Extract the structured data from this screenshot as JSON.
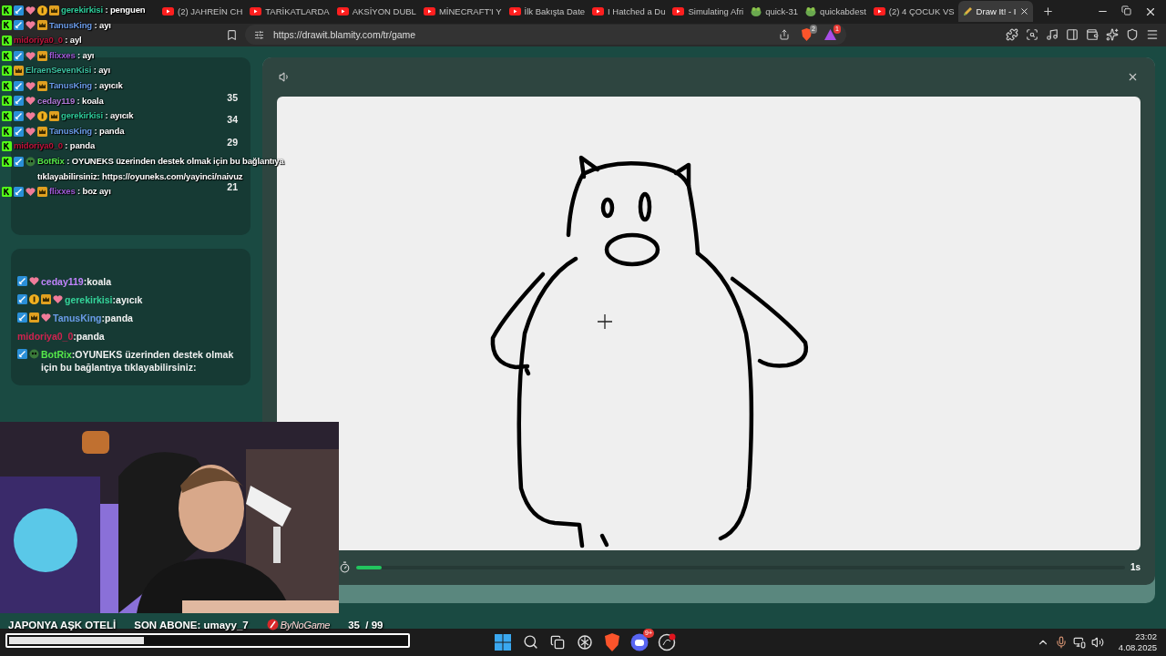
{
  "browser": {
    "tabs": [
      {
        "title": "(2) JAHREİN CH",
        "kind": "video",
        "selected": false
      },
      {
        "title": "TARİKATLARDA",
        "kind": "video",
        "selected": false
      },
      {
        "title": "AKSİYON DUBL",
        "kind": "video",
        "selected": false
      },
      {
        "title": "MİNECRAFT'I Y",
        "kind": "video",
        "selected": false
      },
      {
        "title": "İlk Bakışta Date",
        "kind": "video",
        "selected": false
      },
      {
        "title": "I Hatched a Du",
        "kind": "video",
        "selected": false
      },
      {
        "title": "Simulating Afri",
        "kind": "video",
        "selected": false
      },
      {
        "title": "quick-31",
        "kind": "frog",
        "selected": false
      },
      {
        "title": "quickabdest",
        "kind": "frog",
        "selected": false
      },
      {
        "title": "(2) 4 ÇOCUK VS",
        "kind": "video",
        "selected": false
      },
      {
        "title": "Draw It! - I",
        "kind": "pencil",
        "selected": true
      }
    ],
    "url": "https://drawit.blamity.com/tr/game",
    "shield_badge": "2",
    "rewards_badge": "1"
  },
  "chat_overlay": [
    {
      "user": "gerekirkisi",
      "color": "#2ecc9a",
      "message": ": penguen",
      "badges": [
        {
          "kind": "kick"
        },
        {
          "kind": "sword"
        },
        {
          "kind": "heart"
        },
        {
          "kind": "coin"
        },
        {
          "kind": "crown"
        }
      ]
    },
    {
      "user": "TanusKing",
      "color": "#6a9be8",
      "message": ": ayı",
      "badges": [
        {
          "kind": "kick"
        },
        {
          "kind": "sword"
        },
        {
          "kind": "heart"
        },
        {
          "kind": "crown"
        }
      ]
    },
    {
      "user": "midoriya0_0",
      "color": "#c0143c",
      "message": ": ayl",
      "badges": [
        {
          "kind": "kick"
        }
      ]
    },
    {
      "user": "flixxes",
      "color": "#a05ad8",
      "message": ": ayı",
      "badges": [
        {
          "kind": "kick"
        },
        {
          "kind": "sword"
        },
        {
          "kind": "heart"
        },
        {
          "kind": "crown"
        }
      ]
    },
    {
      "user": "ElraenSevenKisi",
      "color": "#3cc0a0",
      "message": ": ayı",
      "badges": [
        {
          "kind": "kick"
        },
        {
          "kind": "crown"
        }
      ]
    },
    {
      "user": "TanusKing",
      "color": "#6a9be8",
      "message": ": ayıcık",
      "badges": [
        {
          "kind": "kick"
        },
        {
          "kind": "sword"
        },
        {
          "kind": "heart"
        },
        {
          "kind": "crown"
        }
      ]
    },
    {
      "user": "ceday119",
      "color": "#b07ad8",
      "message": ": koala",
      "badges": [
        {
          "kind": "kick"
        },
        {
          "kind": "sword"
        },
        {
          "kind": "heart"
        }
      ]
    },
    {
      "user": "gerekirkisi",
      "color": "#2ecc9a",
      "message": ": ayıcık",
      "badges": [
        {
          "kind": "kick"
        },
        {
          "kind": "sword"
        },
        {
          "kind": "heart"
        },
        {
          "kind": "coin"
        },
        {
          "kind": "crown"
        }
      ]
    },
    {
      "user": "TanusKing",
      "color": "#6a9be8",
      "message": ": panda",
      "badges": [
        {
          "kind": "kick"
        },
        {
          "kind": "sword"
        },
        {
          "kind": "heart"
        },
        {
          "kind": "crown"
        }
      ]
    },
    {
      "user": "midoriya0_0",
      "color": "#c0143c",
      "message": ": panda",
      "badges": [
        {
          "kind": "kick"
        }
      ]
    },
    {
      "user": "BotRix",
      "color": "#56e84a",
      "message": ": OYUNEKS üzerinden destek olmak için bu bağlantıya tıklayabilirsiniz: https://oyuneks.com/yayinci/naivuz",
      "badges": [
        {
          "kind": "kick"
        },
        {
          "kind": "sword"
        },
        {
          "kind": "bot"
        }
      ]
    },
    {
      "user": "flixxes",
      "color": "#a05ad8",
      "message": ": boz ayı",
      "badges": [
        {
          "kind": "kick"
        },
        {
          "kind": "sword"
        },
        {
          "kind": "heart"
        },
        {
          "kind": "crown"
        }
      ]
    }
  ],
  "leaderboard": [
    {
      "score": "35"
    },
    {
      "score": "34"
    },
    {
      "score": "29"
    },
    {
      "score": "21"
    }
  ],
  "chat_panel": [
    {
      "user": "ceday119",
      "color": "#c084fc",
      "message": ":koala",
      "badges": [
        {
          "kind": "sword"
        },
        {
          "kind": "heart"
        }
      ]
    },
    {
      "user": "gerekirkisi",
      "color": "#34d399",
      "message": ":ayıcık",
      "badges": [
        {
          "kind": "sword"
        },
        {
          "kind": "coin"
        },
        {
          "kind": "crown"
        },
        {
          "kind": "heart"
        }
      ]
    },
    {
      "user": "TanusKing",
      "color": "#6a9be8",
      "message": ":panda",
      "badges": [
        {
          "kind": "sword"
        },
        {
          "kind": "crown"
        },
        {
          "kind": "heart"
        }
      ]
    },
    {
      "user": "midoriya0_0",
      "color": "#d0234f",
      "message": ":panda"
    },
    {
      "user": "BotRix",
      "color": "#56e84a",
      "message": ":OYUNEKS üzerinden destek olmak için bu bağlantıya tıklayabilirsiniz:",
      "badges": [
        {
          "kind": "sword"
        },
        {
          "kind": "bot"
        }
      ]
    }
  ],
  "game": {
    "timer": {
      "level": 0.033
    },
    "time_left": "1s"
  },
  "stream_bar": {
    "title": "JAPONYA AŞK OTELİ",
    "last_sub": "SON ABONE: umayy_7",
    "sponsor": "ByNoGame",
    "goal": "35  / 99",
    "goal_bar": {
      "level": 0.34
    }
  },
  "taskbar": {
    "discord_badge": "9+",
    "time": "23:02",
    "date": "4.08.2025"
  }
}
